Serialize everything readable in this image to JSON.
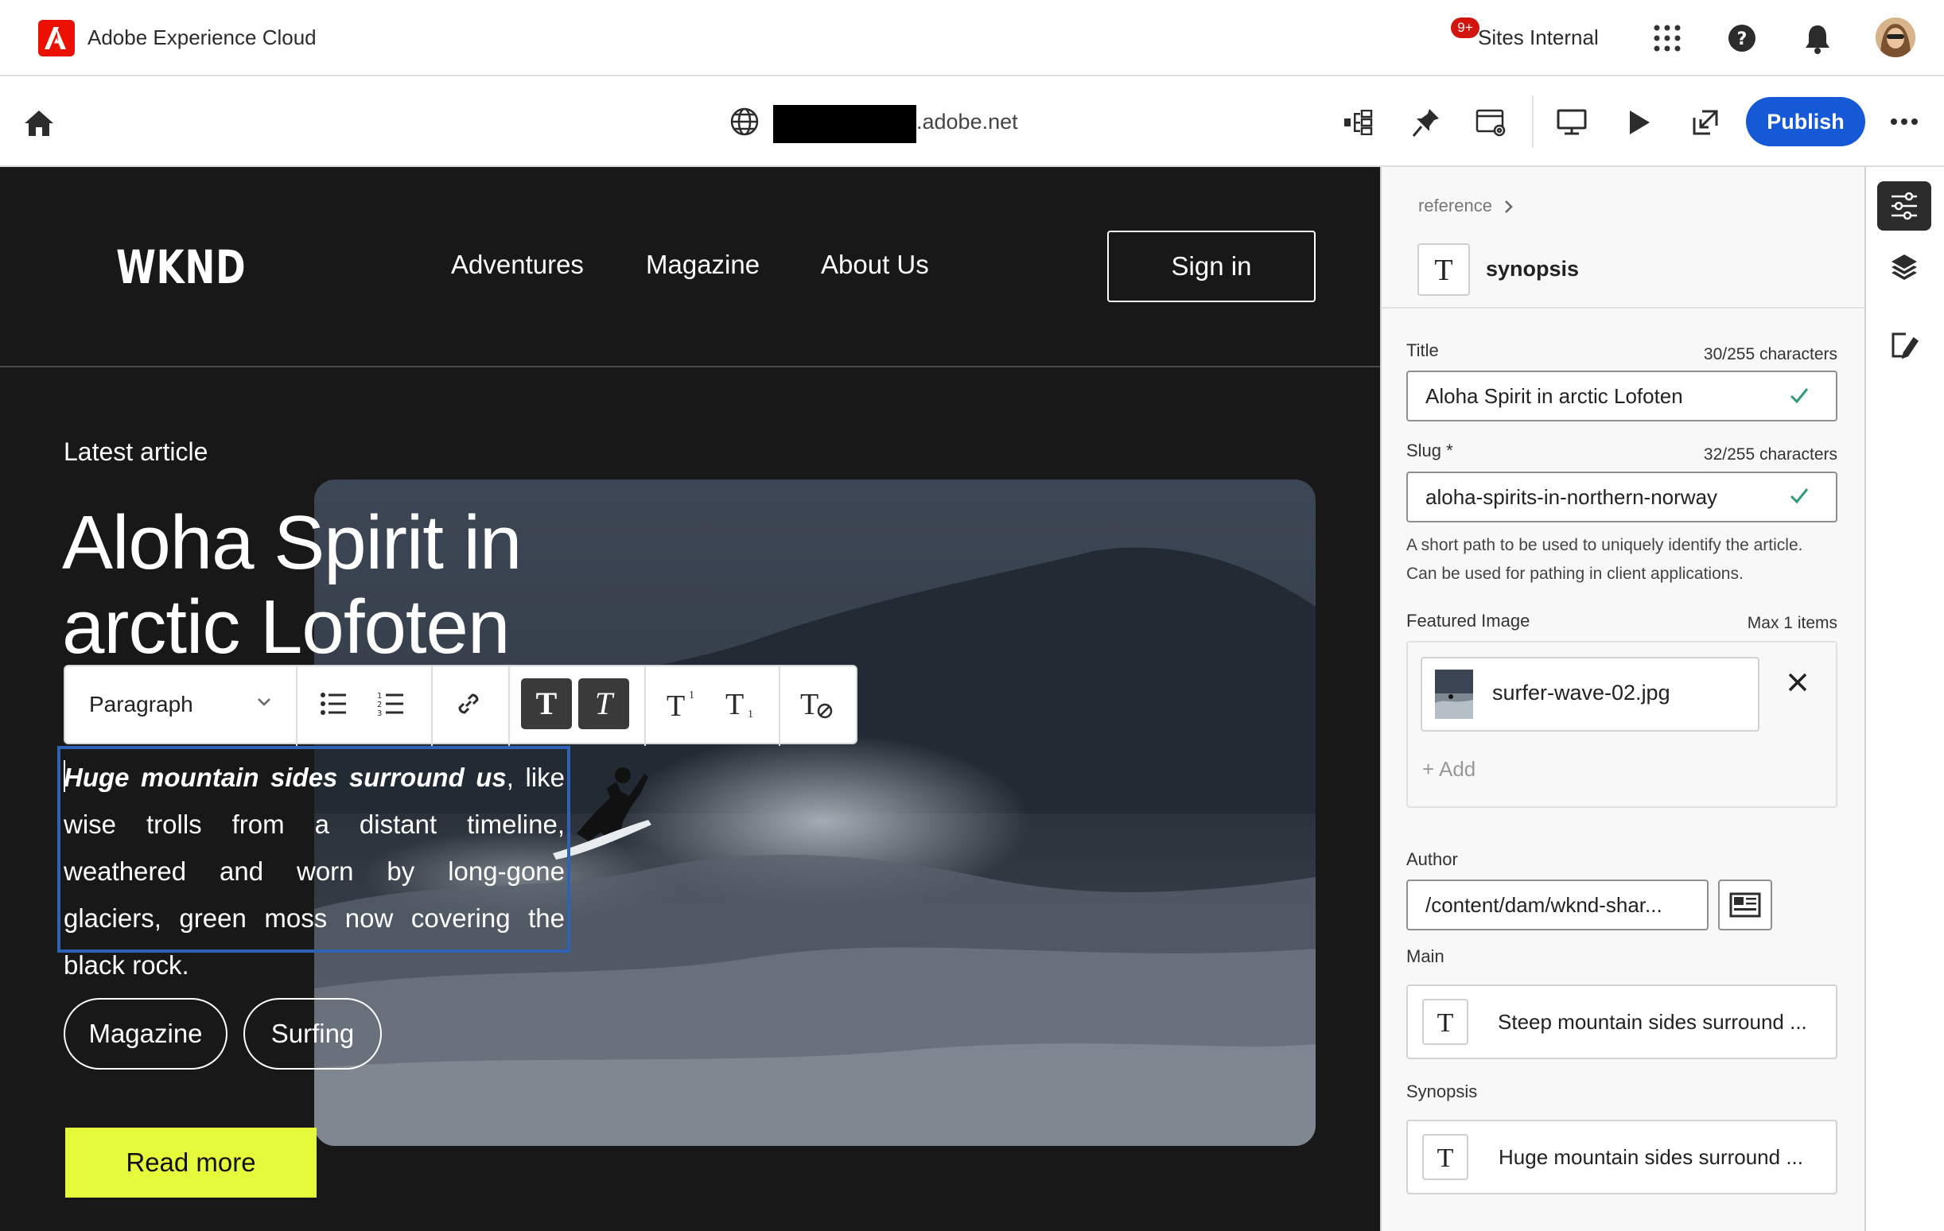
{
  "shell": {
    "app_title": "Adobe Experience Cloud",
    "org_name": "Sites Internal",
    "notification_count": "9+"
  },
  "toolbar": {
    "url_domain": ".adobe.net",
    "publish_label": "Publish"
  },
  "page": {
    "logo": "WKND",
    "nav": [
      "Adventures",
      "Magazine",
      "About Us"
    ],
    "sign_in": "Sign in",
    "latest_label": "Latest article",
    "headline_line1": "Aloha Spirit in",
    "headline_line2": "arctic Lofoten",
    "synopsis_bold": "Huge mountain sides surround us",
    "synopsis_rest": ", like wise trolls from a distant timeline, weathered and worn by long-gone glaciers, green moss now covering the black rock.",
    "tags": [
      "Magazine",
      "Surfing"
    ],
    "read_more": "Read more"
  },
  "rte": {
    "format_selected": "Paragraph"
  },
  "panel": {
    "breadcrumb": "reference",
    "field_name": "synopsis",
    "title_label": "Title",
    "title_count": "30/255 characters",
    "title_value": "Aloha Spirit in arctic Lofoten",
    "slug_label": "Slug",
    "slug_required": "*",
    "slug_count": "32/255 characters",
    "slug_value": "aloha-spirits-in-northern-norway",
    "slug_help_1": "A short path to be used to uniquely identify the article.",
    "slug_help_2": "Can be used for pathing in client applications.",
    "featured_label": "Featured Image",
    "featured_max": "Max 1 items",
    "image_name": "surfer-wave-02.jpg",
    "add_label": "+ Add",
    "author_label": "Author",
    "author_value": "/content/dam/wknd-shar...",
    "main_label": "Main",
    "main_value": "Steep mountain sides surround ...",
    "synopsis_label": "Synopsis",
    "synopsis_value": "Huge mountain sides surround ..."
  },
  "colors": {
    "adobe_red": "#eb1000",
    "publish_blue": "#1659d6",
    "canvas_bg": "#181818",
    "read_more_bg": "#e6fa3c",
    "selection_border": "#2f62b4",
    "check_green": "#2d9d78"
  },
  "icons": [
    "adobe-logo-icon",
    "apps-grid-icon",
    "help-icon",
    "bell-icon",
    "home-icon",
    "globe-icon",
    "content-tree-icon",
    "pin-icon",
    "page-settings-icon",
    "desktop-icon",
    "play-icon",
    "open-external-icon",
    "more-icon",
    "chevron-down-icon",
    "bullet-list-icon",
    "numbered-list-icon",
    "link-icon",
    "bold-icon",
    "italic-icon",
    "superscript-icon",
    "subscript-icon",
    "clear-format-icon",
    "chevron-right-icon",
    "text-type-icon",
    "check-icon",
    "close-icon",
    "content-picker-icon",
    "properties-icon",
    "layers-icon",
    "edit-note-icon"
  ]
}
